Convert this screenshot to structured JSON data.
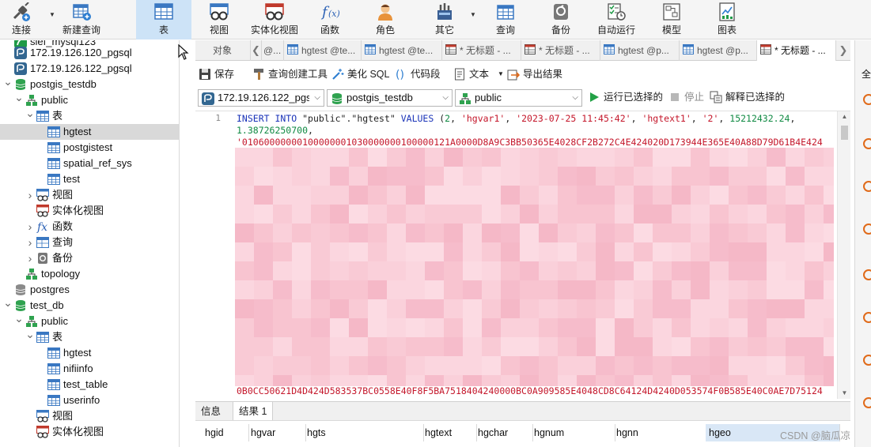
{
  "toolbar": {
    "items": [
      {
        "label": "连接",
        "icon": "connection-icon"
      },
      {
        "label": "新建查询",
        "icon": "new-query-icon"
      },
      {
        "label": "表",
        "icon": "table-icon",
        "active": true
      },
      {
        "label": "视图",
        "icon": "view-icon"
      },
      {
        "label": "实体化视图",
        "icon": "materialized-view-icon"
      },
      {
        "label": "函数",
        "icon": "function-icon"
      },
      {
        "label": "角色",
        "icon": "role-icon"
      },
      {
        "label": "其它",
        "icon": "other-icon"
      },
      {
        "label": "查询",
        "icon": "query-icon"
      },
      {
        "label": "备份",
        "icon": "backup-icon"
      },
      {
        "label": "自动运行",
        "icon": "automation-icon"
      },
      {
        "label": "模型",
        "icon": "model-icon"
      },
      {
        "label": "图表",
        "icon": "chart-icon"
      }
    ]
  },
  "navigator": {
    "rows": [
      {
        "label": "slef_mysql123",
        "icon": "mysql"
      },
      {
        "label": "172.19.126.120_pgsql",
        "icon": "pg"
      },
      {
        "label": "172.19.126.122_pgsql",
        "icon": "pg"
      },
      {
        "label": "postgis_testdb",
        "icon": "db"
      },
      {
        "label": "public",
        "icon": "schema"
      },
      {
        "label": "表",
        "icon": "table"
      },
      {
        "label": "hgtest",
        "icon": "table"
      },
      {
        "label": "postgistest",
        "icon": "table"
      },
      {
        "label": "spatial_ref_sys",
        "icon": "table"
      },
      {
        "label": "test",
        "icon": "table"
      },
      {
        "label": "视图",
        "icon": "view"
      },
      {
        "label": "实体化视图",
        "icon": "mview"
      },
      {
        "label": "函数",
        "icon": "func"
      },
      {
        "label": "查询",
        "icon": "query"
      },
      {
        "label": "备份",
        "icon": "backup"
      },
      {
        "label": "topology",
        "icon": "schema"
      },
      {
        "label": "postgres",
        "icon": "dbgray"
      },
      {
        "label": "test_db",
        "icon": "db"
      },
      {
        "label": "public",
        "icon": "schema"
      },
      {
        "label": "表",
        "icon": "table"
      },
      {
        "label": "hgtest",
        "icon": "table"
      },
      {
        "label": "nifiinfo",
        "icon": "table"
      },
      {
        "label": "test_table",
        "icon": "table"
      },
      {
        "label": "userinfo",
        "icon": "table"
      },
      {
        "label": "视图",
        "icon": "view"
      },
      {
        "label": "实体化视图",
        "icon": "mview"
      }
    ]
  },
  "object_tabs": [
    {
      "label": "对象"
    },
    {
      "label": "@..."
    },
    {
      "label": "hgtest @te..."
    },
    {
      "label": "hgtest @te..."
    },
    {
      "label": "* 无标题 - ..."
    },
    {
      "label": "* 无标题 - ..."
    },
    {
      "label": "hgtest @p..."
    },
    {
      "label": "hgtest @p..."
    },
    {
      "label": "* 无标题 - ..."
    }
  ],
  "query_toolbar": {
    "save": "保存",
    "builder": "查询创建工具",
    "beautify": "美化 SQL",
    "snippet": "代码段",
    "text": "文本",
    "export": "导出结果"
  },
  "connection_bar": {
    "connection": "172.19.126.122_pgsql",
    "database": "postgis_testdb",
    "schema": "public",
    "run_selected": "运行已选择的",
    "stop": "停止",
    "explain_selected": "解释已选择的"
  },
  "editor": {
    "line_number": "1",
    "line1": {
      "t1": "INSERT INTO",
      "t2": " \"public\".\"hgtest\" ",
      "t3": "VALUES",
      "t4": " (",
      "t5": "2",
      "t6": ", ",
      "t7": "'hgvar1'",
      "t8": ", ",
      "t9": "'2023-07-25 11:45:42'",
      "t10": ", ",
      "t11": "'hgtext1'",
      "t12": ", ",
      "t13": "'2'",
      "t14": ", ",
      "t15": "15212432.24",
      "t16": ","
    },
    "line2": {
      "num": "1.38726250700",
      "comma": ","
    },
    "line3": "'01060000000100000001030000000100000121A0000D8A9C3BB50365E4028CF2B272C4E424020D173944E365E40A88D79D61B4E424",
    "line_last": "0B0CC50621D4D424D583537BC0558E40F8F5BA7518404240000BC0A909585E4048CD8C64124D4240D053574F0B585E40C0AE7D75124"
  },
  "result_tabs": {
    "info": "信息",
    "result1": "结果 1"
  },
  "grid": {
    "columns": [
      "hgid",
      "hgvar",
      "hgts",
      "hgtext",
      "hgchar",
      "hgnum",
      "hgnn",
      "hgeo"
    ]
  },
  "right_panel": {
    "label": "全"
  },
  "watermark": "CSDN @脑瓜凉",
  "colors": {
    "accent": "#cde3f7",
    "keyword": "#1a33b8",
    "string": "#c4162a",
    "number": "#108a43",
    "mosaic": "#f8c8d4"
  }
}
